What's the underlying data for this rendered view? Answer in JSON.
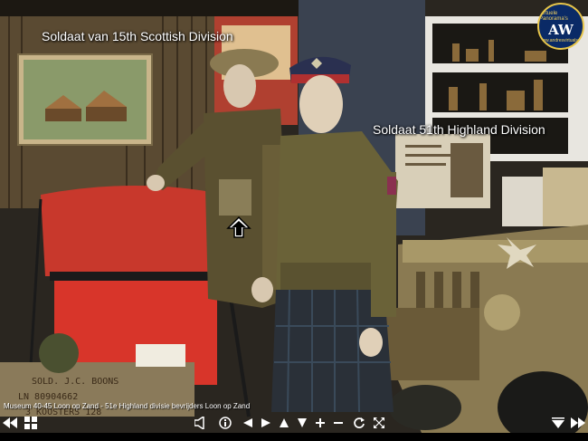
{
  "panorama": {
    "hotspot_1": "Soldaat van 15th Scottish Division",
    "hotspot_2": "Soldaat 51th Highland Division",
    "caption": "Museum 40-45 Loon op Zand - 51e Highland divisie bevrijders Loon op Zand"
  },
  "logo": {
    "top_text": "Virtuele Panorama's",
    "monogram": "AW",
    "bottom_text": "www.andresvirtuals.nl"
  },
  "scene_text": {
    "crate": "SOLD. J.C. BOONS",
    "crate_line2": "LN 80904662",
    "crate_line3": "3 KOOSTERS 128"
  },
  "toolbar": {
    "icons": [
      "rewind-icon",
      "grid-icon",
      "speaker-icon",
      "info-icon",
      "arrow-left-icon",
      "arrow-right-icon",
      "arrow-up-icon",
      "arrow-down-icon",
      "zoom-in-icon",
      "zoom-out-icon",
      "rotate-icon",
      "fullscreen-icon",
      "triangle-down-icon",
      "fast-forward-icon"
    ]
  },
  "colors": {
    "logo_bg": "#0a2a66",
    "logo_ring": "#e8c64a"
  }
}
